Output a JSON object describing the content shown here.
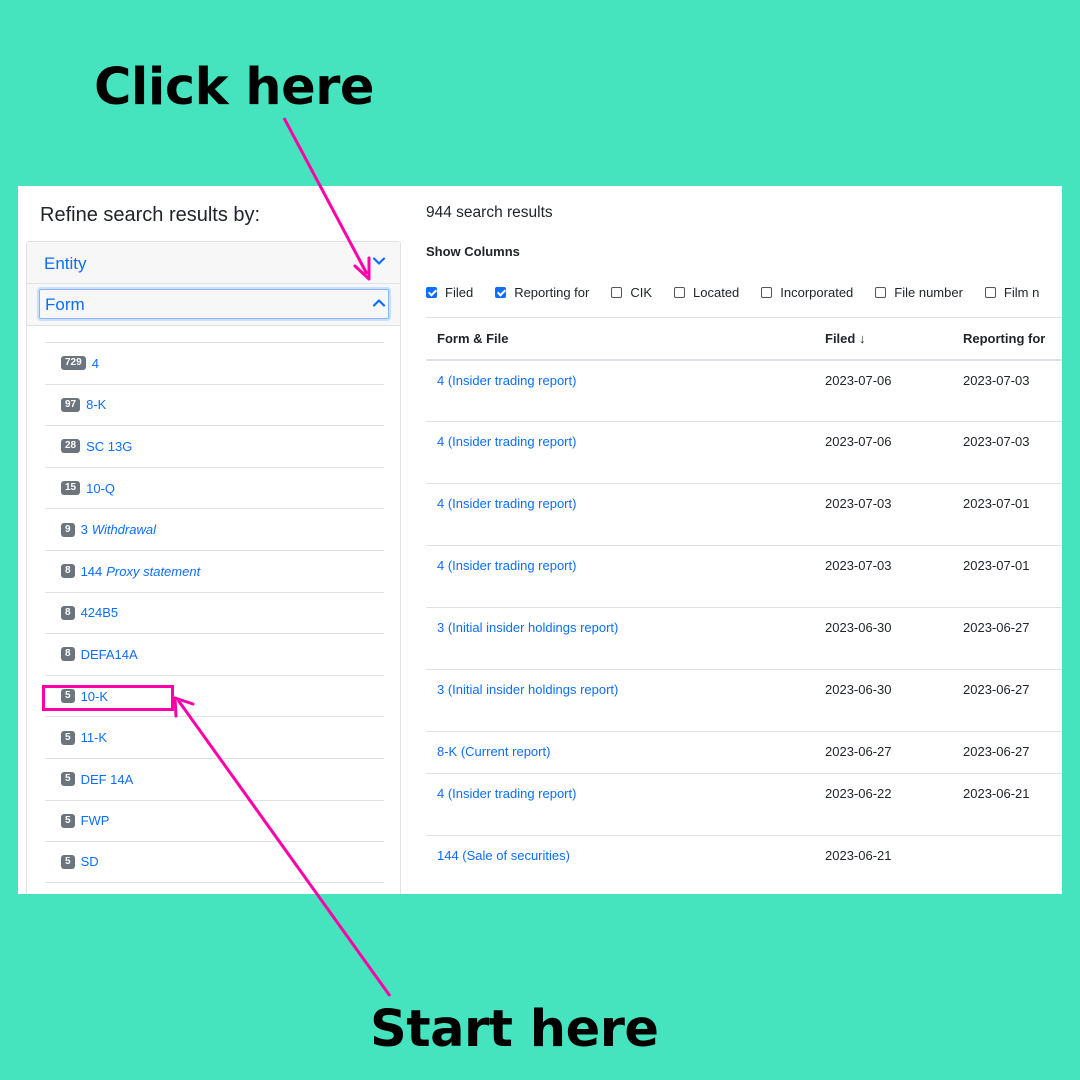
{
  "callouts": {
    "top": "Click here",
    "bottom": "Start here"
  },
  "colors": {
    "background": "#45e4be",
    "link": "#0d6efd",
    "highlight": "#ff00a8",
    "badge": "#6c757d"
  },
  "sidebar": {
    "title": "Refine search results by:",
    "facets": [
      {
        "label": "Entity",
        "icon": "chevron-down-icon",
        "expanded": false
      },
      {
        "label": "Form",
        "icon": "chevron-up-icon",
        "expanded": true
      }
    ],
    "form_items": [
      {
        "count": "729",
        "label": "4",
        "desc": ""
      },
      {
        "count": "97",
        "label": "8-K",
        "desc": ""
      },
      {
        "count": "28",
        "label": "SC 13G",
        "desc": ""
      },
      {
        "count": "15",
        "label": "10-Q",
        "desc": ""
      },
      {
        "count": "9",
        "label": "3",
        "desc": "Withdrawal"
      },
      {
        "count": "8",
        "label": "144",
        "desc": "Proxy statement"
      },
      {
        "count": "8",
        "label": "424B5",
        "desc": ""
      },
      {
        "count": "8",
        "label": "DEFA14A",
        "desc": ""
      },
      {
        "count": "5",
        "label": "10-K",
        "desc": ""
      },
      {
        "count": "5",
        "label": "11-K",
        "desc": ""
      },
      {
        "count": "5",
        "label": "DEF 14A",
        "desc": ""
      },
      {
        "count": "5",
        "label": "FWP",
        "desc": ""
      },
      {
        "count": "5",
        "label": "SD",
        "desc": ""
      }
    ]
  },
  "main": {
    "results_count": "944 search results",
    "show_columns_label": "Show Columns",
    "column_toggles": [
      {
        "label": "Filed",
        "checked": true
      },
      {
        "label": "Reporting for",
        "checked": true
      },
      {
        "label": "CIK",
        "checked": false
      },
      {
        "label": "Located",
        "checked": false
      },
      {
        "label": "Incorporated",
        "checked": false
      },
      {
        "label": "File number",
        "checked": false
      },
      {
        "label": "Film n",
        "checked": false
      }
    ],
    "table": {
      "headers": [
        "Form & File",
        "Filed ↓",
        "Reporting for"
      ],
      "rows": [
        {
          "form": "4 (Insider trading report)",
          "filed": "2023-07-06",
          "reporting": "2023-07-03",
          "height": "tall"
        },
        {
          "form": "4 (Insider trading report)",
          "filed": "2023-07-06",
          "reporting": "2023-07-03",
          "height": "tall"
        },
        {
          "form": "4 (Insider trading report)",
          "filed": "2023-07-03",
          "reporting": "2023-07-01",
          "height": "tall"
        },
        {
          "form": "4 (Insider trading report)",
          "filed": "2023-07-03",
          "reporting": "2023-07-01",
          "height": "tall"
        },
        {
          "form": "3 (Initial insider holdings report)",
          "filed": "2023-06-30",
          "reporting": "2023-06-27",
          "height": "tall"
        },
        {
          "form": "3 (Initial insider holdings report)",
          "filed": "2023-06-30",
          "reporting": "2023-06-27",
          "height": "tall"
        },
        {
          "form": "8-K (Current report)",
          "filed": "2023-06-27",
          "reporting": "2023-06-27",
          "height": "short"
        },
        {
          "form": "4 (Insider trading report)",
          "filed": "2023-06-22",
          "reporting": "2023-06-21",
          "height": "tall"
        },
        {
          "form": "144 (Sale of securities)",
          "filed": "2023-06-21",
          "reporting": "",
          "height": "tall"
        }
      ]
    }
  }
}
